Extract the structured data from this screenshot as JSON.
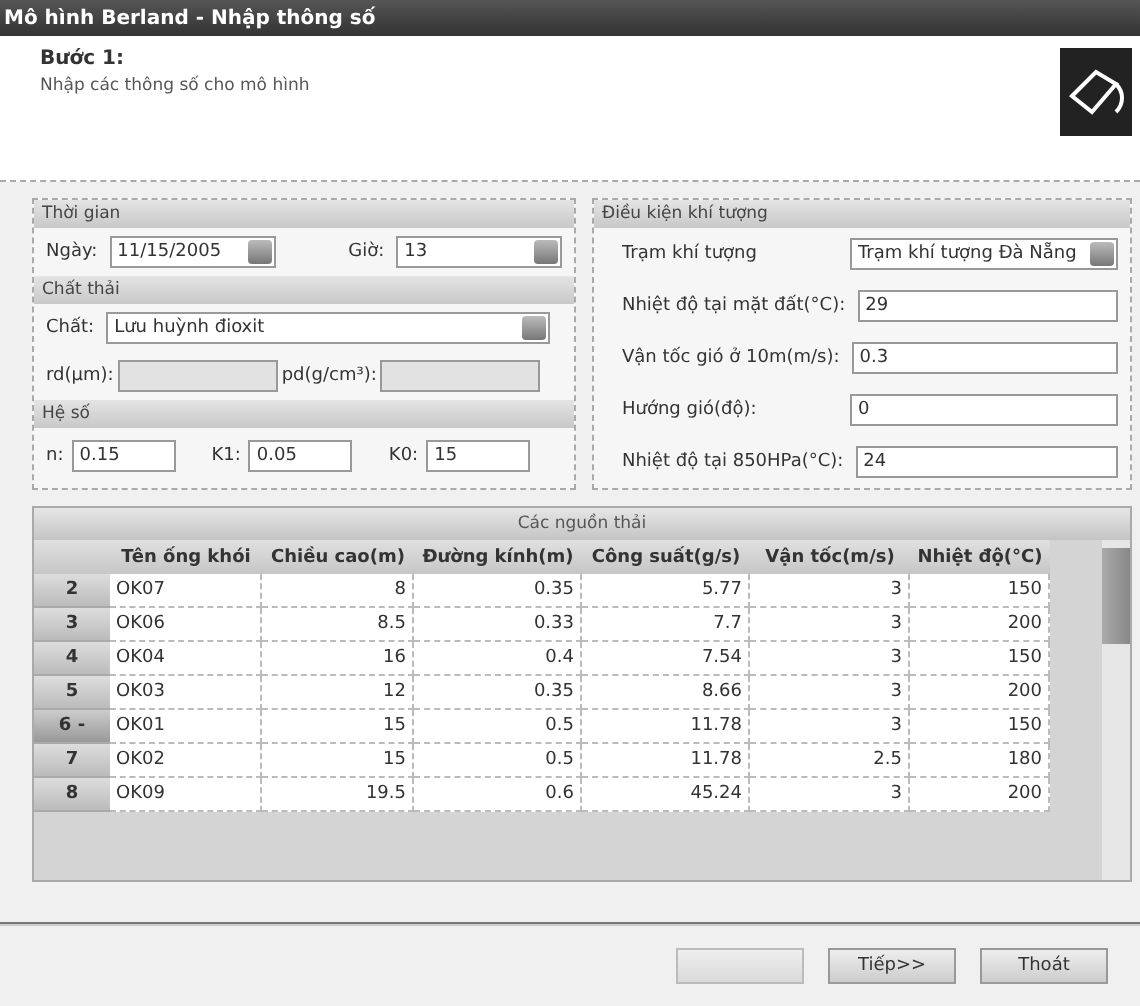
{
  "window": {
    "title": "Mô hình Berland - Nhập thông số"
  },
  "header": {
    "step": "Bước 1:",
    "description": "Nhập các thông số cho mô hình"
  },
  "time": {
    "title": "Thời gian",
    "date_label": "Ngày:",
    "date": "11/15/2005",
    "hour_label": "Giờ:",
    "hour": "13"
  },
  "waste": {
    "title": "Chất thải",
    "substance_label": "Chất:",
    "substance": "Lưu huỳnh đioxit",
    "rd_label": "rd(µm):",
    "pd_label": "pd(g/cm³):",
    "disabled": true
  },
  "coefficients": {
    "title": "Hệ số",
    "fields": [
      {
        "label": "n:",
        "value": "0.15"
      },
      {
        "label": "K1:",
        "value": "0.05"
      },
      {
        "label": "K0:",
        "value": "15"
      }
    ]
  },
  "weather": {
    "title": "Điều kiện khí tượng",
    "station_label": "Trạm khí tượng",
    "station": "Trạm khí tượng Đà Nẵng",
    "fields": [
      {
        "label": "Nhiệt độ tại mặt đất(°C):",
        "value": "29"
      },
      {
        "label": "Vận tốc gió ở 10m(m/s):",
        "value": "0.3"
      },
      {
        "label": "Hướng gió(độ):",
        "value": "0"
      },
      {
        "label": "Nhiệt độ tại 850HPa(°C):",
        "value": "24"
      }
    ]
  },
  "table": {
    "title": "Các nguồn thải",
    "columns": [
      "Tên ống khói",
      "Chiều cao(m)",
      "Đường kính(m)",
      "Công suất(g/s)",
      "Vận tốc(m/s)",
      "Nhiệt độ(°C)"
    ],
    "rows": [
      {
        "header": "2",
        "current": false,
        "cells": [
          "OK07",
          "8",
          "0.35",
          "5.77",
          "3",
          "150"
        ]
      },
      {
        "header": "3",
        "current": false,
        "cells": [
          "OK06",
          "8.5",
          "0.33",
          "7.7",
          "3",
          "200"
        ]
      },
      {
        "header": "4",
        "current": false,
        "cells": [
          "OK04",
          "16",
          "0.4",
          "7.54",
          "3",
          "150"
        ]
      },
      {
        "header": "5",
        "current": false,
        "cells": [
          "OK03",
          "12",
          "0.35",
          "8.66",
          "3",
          "200"
        ]
      },
      {
        "header": "6 -",
        "current": true,
        "cells": [
          "OK01",
          "15",
          "0.5",
          "11.78",
          "3",
          "150"
        ]
      },
      {
        "header": "7",
        "current": false,
        "cells": [
          "OK02",
          "15",
          "0.5",
          "11.78",
          "2.5",
          "180"
        ]
      },
      {
        "header": "8",
        "current": false,
        "cells": [
          "OK09",
          "19.5",
          "0.6",
          "45.24",
          "3",
          "200"
        ]
      }
    ]
  },
  "buttons": [
    {
      "disabled": true
    },
    {
      "label": "Tiếp>>",
      "disabled": false
    },
    {
      "label": "Thoát",
      "disabled": false
    }
  ]
}
